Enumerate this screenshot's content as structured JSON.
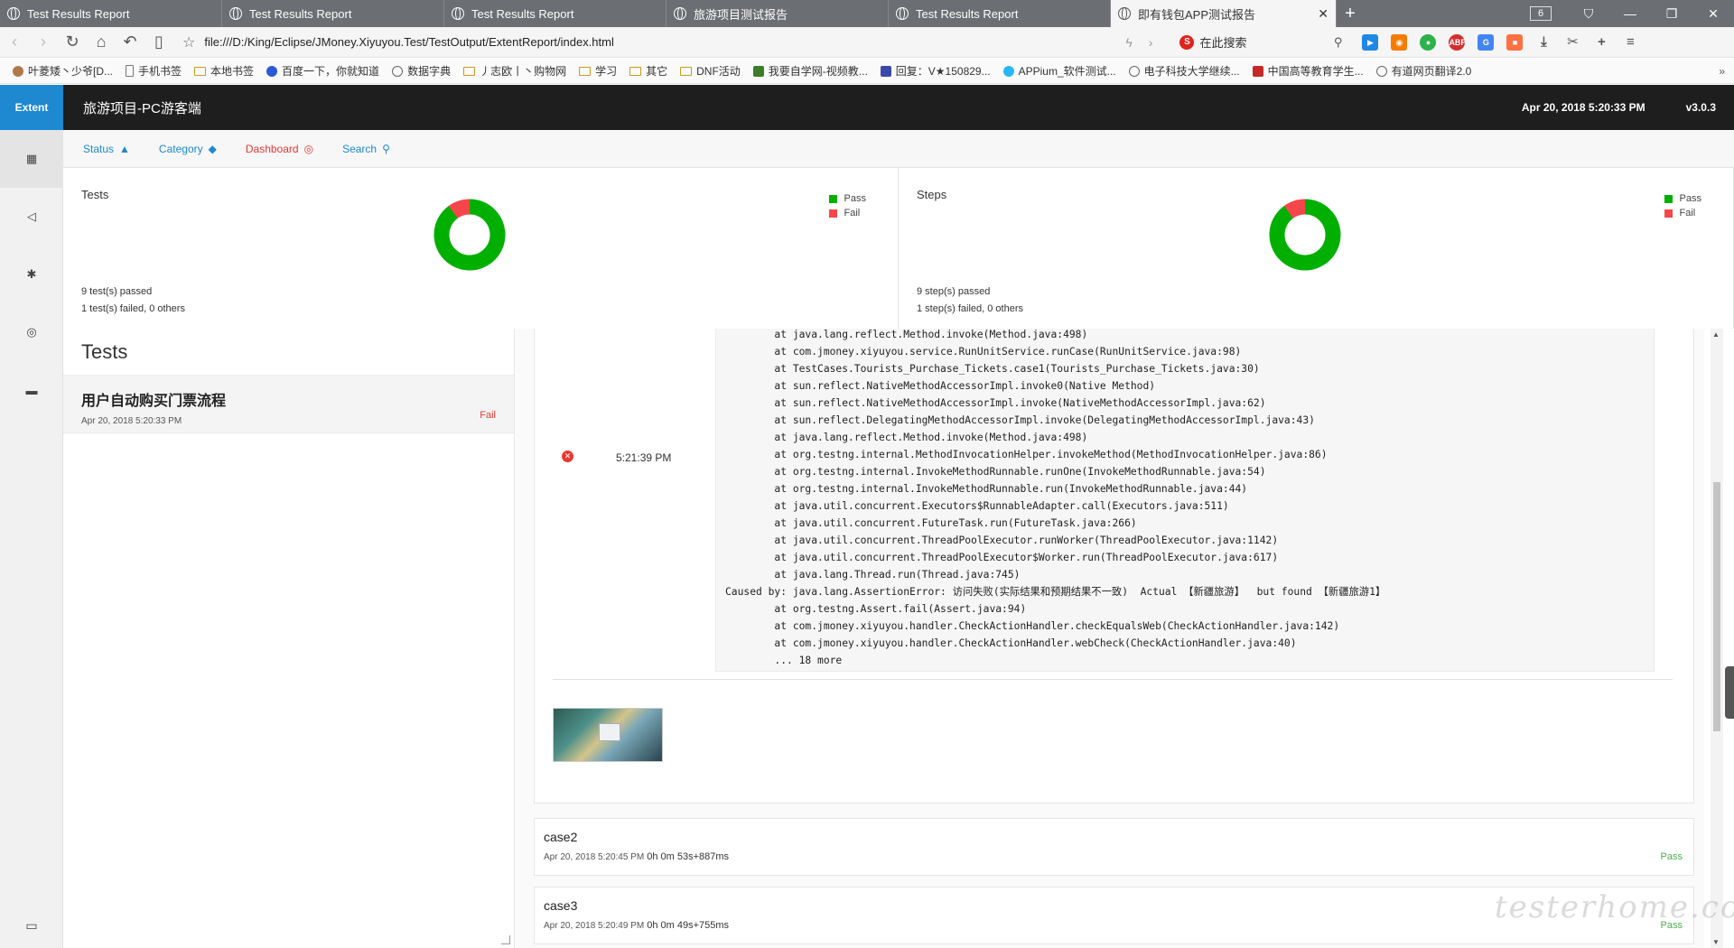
{
  "browser": {
    "tabs": [
      {
        "title": "Test Results Report",
        "active": false
      },
      {
        "title": "Test Results Report",
        "active": false
      },
      {
        "title": "Test Results Report",
        "active": false
      },
      {
        "title": "旅游项目测试报告",
        "active": false
      },
      {
        "title": "Test Results Report",
        "active": false
      },
      {
        "title": "即有钱包APP测试报告",
        "active": true
      }
    ],
    "tab_count": "6",
    "url": "file:///D:/King/Eclipse/JMoney.Xiyuyou.Test/TestOutput/ExtentReport/index.html",
    "search_placeholder": "在此搜索",
    "bookmarks": [
      "叶菱矮丶少爷[D...",
      "手机书签",
      "本地书签",
      "百度一下，你就知道",
      "数据字典",
      "丿志欧丨丶购物网",
      "学习",
      "其它",
      "DNF活动",
      "我要自学网-视频教...",
      "回复：V★150829...",
      "APPium_软件测试...",
      "电子科技大学继续...",
      "中国高等教育学生...",
      "有道网页翻译2.0"
    ]
  },
  "report": {
    "brand": "Extent",
    "name": "旅游项目-PC游客端",
    "datetime": "Apr 20, 2018 5:20:33 PM",
    "version": "v3.0.3",
    "subnav": {
      "status": "Status",
      "category": "Category",
      "dashboard": "Dashboard",
      "search": "Search"
    },
    "colors": {
      "pass": "#00af00",
      "fail": "#f7464a",
      "accent": "#1e88d1"
    }
  },
  "dashboard": {
    "tests": {
      "title": "Tests",
      "pass_label": "Pass",
      "fail_label": "Fail",
      "passed_text": "9 test(s) passed",
      "failed_text": "1 test(s) failed, 0 others",
      "pass": 9,
      "fail": 1
    },
    "steps": {
      "title": "Steps",
      "pass_label": "Pass",
      "fail_label": "Fail",
      "passed_text": "9 step(s) passed",
      "failed_text": "1 step(s) failed, 0 others",
      "pass": 9,
      "fail": 1
    }
  },
  "tests_panel": {
    "heading": "Tests",
    "items": [
      {
        "name": "用户自动购买门票流程",
        "time": "Apr 20, 2018 5:20:33 PM",
        "status": "Fail"
      }
    ]
  },
  "step": {
    "time": "5:21:39 PM",
    "stacktrace": "        at java.lang.reflect.Method.invoke(Method.java:498)\n        at com.jmoney.xiyuyou.service.RunUnitService.runCase(RunUnitService.java:98)\n        at TestCases.Tourists_Purchase_Tickets.case1(Tourists_Purchase_Tickets.java:30)\n        at sun.reflect.NativeMethodAccessorImpl.invoke0(Native Method)\n        at sun.reflect.NativeMethodAccessorImpl.invoke(NativeMethodAccessorImpl.java:62)\n        at sun.reflect.DelegatingMethodAccessorImpl.invoke(DelegatingMethodAccessorImpl.java:43)\n        at java.lang.reflect.Method.invoke(Method.java:498)\n        at org.testng.internal.MethodInvocationHelper.invokeMethod(MethodInvocationHelper.java:86)\n        at org.testng.internal.InvokeMethodRunnable.runOne(InvokeMethodRunnable.java:54)\n        at org.testng.internal.InvokeMethodRunnable.run(InvokeMethodRunnable.java:44)\n        at java.util.concurrent.Executors$RunnableAdapter.call(Executors.java:511)\n        at java.util.concurrent.FutureTask.run(FutureTask.java:266)\n        at java.util.concurrent.ThreadPoolExecutor.runWorker(ThreadPoolExecutor.java:1142)\n        at java.util.concurrent.ThreadPoolExecutor$Worker.run(ThreadPoolExecutor.java:617)\n        at java.lang.Thread.run(Thread.java:745)\nCaused by: java.lang.AssertionError: 访问失败(实际结果和预期结果不一致)  Actual 【新疆旅游】  but found 【新疆旅游1】\n        at org.testng.Assert.fail(Assert.java:94)\n        at com.jmoney.xiyuyou.handler.CheckActionHandler.checkEqualsWeb(CheckActionHandler.java:142)\n        at com.jmoney.xiyuyou.handler.CheckActionHandler.webCheck(CheckActionHandler.java:40)\n        ... 18 more"
  },
  "cases": [
    {
      "name": "case2",
      "time": "Apr 20, 2018 5:20:45 PM",
      "duration": "0h 0m 53s+887ms",
      "status": "Pass"
    },
    {
      "name": "case3",
      "time": "Apr 20, 2018 5:20:49 PM",
      "duration": "0h 0m 49s+755ms",
      "status": "Pass"
    }
  ],
  "watermark": "testerhome.com"
}
